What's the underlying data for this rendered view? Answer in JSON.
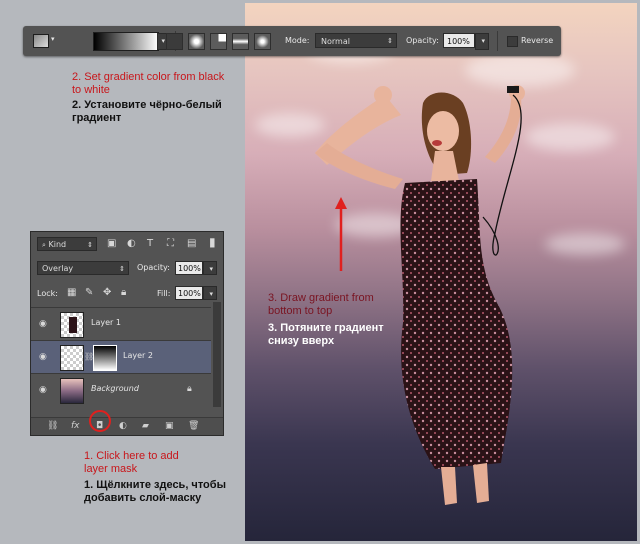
{
  "options_bar": {
    "mode_label": "Mode:",
    "mode_value": "Normal",
    "opacity_label": "Opacity:",
    "opacity_value": "100%",
    "reverse_label": "Reverse",
    "gradient_preview": [
      "#000000",
      "#ffffff"
    ]
  },
  "layers_panel": {
    "filter_kind": "Kind",
    "blend_mode": "Overlay",
    "opacity_label": "Opacity:",
    "opacity_value": "100%",
    "lock_label": "Lock:",
    "fill_label": "Fill:",
    "fill_value": "100%",
    "layers": [
      {
        "name": "Layer 1",
        "selected": false
      },
      {
        "name": "Layer 2",
        "selected": true
      },
      {
        "name": "Background",
        "selected": false,
        "locked": true
      }
    ]
  },
  "annotations": {
    "step2_en": "2. Set gradient color from black to white",
    "step2_ru": "2. Установите чёрно-белый градиент",
    "step1_en": "1. Click here to add layer mask",
    "step1_ru": "1. Щёлкните здесь, чтобы добавить слой-маску",
    "step3_en": "3. Draw gradient from bottom to top",
    "step3_ru": "3. Потяните градиент снизу вверх"
  },
  "colors": {
    "panel": "#535353",
    "highlight": "#c8161b",
    "selected_layer": "#5a6179"
  }
}
